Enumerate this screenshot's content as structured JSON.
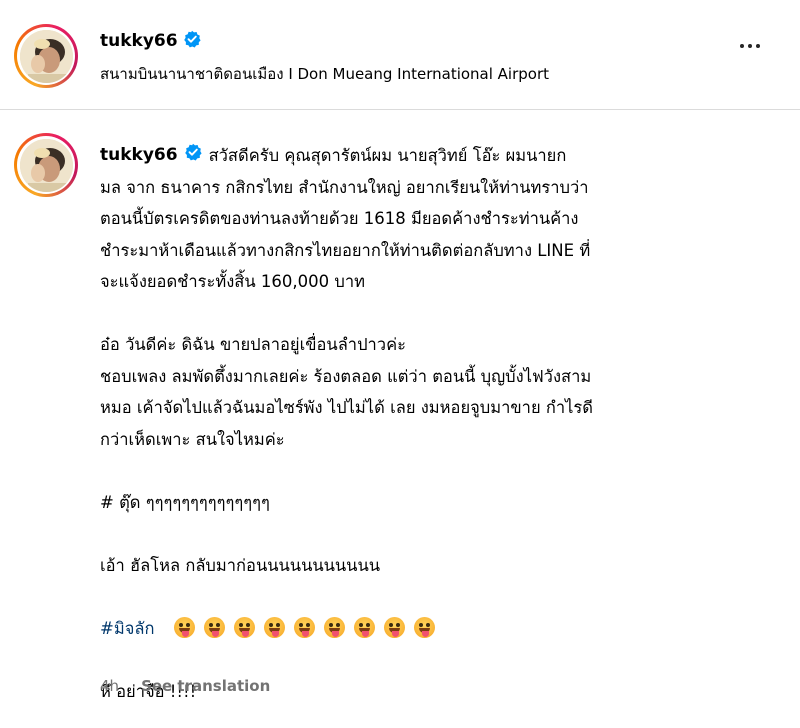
{
  "post": {
    "username": "tukky66",
    "verified": true,
    "location": "สนามบินนานาชาติดอนเมือง I Don Mueang International Airport",
    "more_icon": "more-horizontal-icon"
  },
  "comment": {
    "username": "tukky66",
    "verified": true,
    "first_line_text": "สวัสดีครับ￼ คุณสุดารัตน์ผม￼ นายสุวิทย์ โอ๊ะ ผมนายก",
    "lines": [
      "มล จาก ธนาคาร กสิกรไทย สำนักงานใหญ่ อยากเรียนให้ท่านทราบว่า",
      "ตอนนี้บัตรเครดิตของท่านลงท้ายด้วย 1618 มียอดค้างชำระท่านค้าง",
      "ชำระมาห้าเดือนแล้วทางกสิกรไทยอยากให้ท่านติดต่อกลับทาง LINE ที่",
      "จะแจ้งยอดชำระทั้งสิ้น 160,000 บาท￼",
      "",
      "อ๋อ วันดีค่ะ ดิฉัน ขายปลาอยู่เขื่อนลำปาวค่ะ",
      "ชอบเพลง ลมพัดตึ้งมากเลยค่ะ ร้องตลอด แต่ว่า ตอนนี้ บุญบั้งไฟวังสาม",
      "หมอ เค้าจัดไปแล้วฉันมอไซร์พัง ไปไม่ได้ เลย งมหอยจูบมาขาย กำไรดี",
      "กว่าเห็ดเพาะ สนใจไหมค่ะ",
      "",
      "# ตุ๊ด ๆๆๆๆๆๆๆๆๆๆๆๆๆๆ",
      "",
      "เอ้า ฮัลโหล กลับมาก่อนนนนนนนนนนน",
      ""
    ],
    "hashtag": "#มิจลัก",
    "emoji_count": 9,
    "emoji_name": "zany-face-emoji",
    "last_line": "หึ อย่าจือ !!!!"
  },
  "meta": {
    "time": "4h",
    "translate": "See translation"
  },
  "colors": {
    "link": "#00376b",
    "verified": "#0095f6",
    "muted": "#737373",
    "divider": "#dbdbdb"
  }
}
